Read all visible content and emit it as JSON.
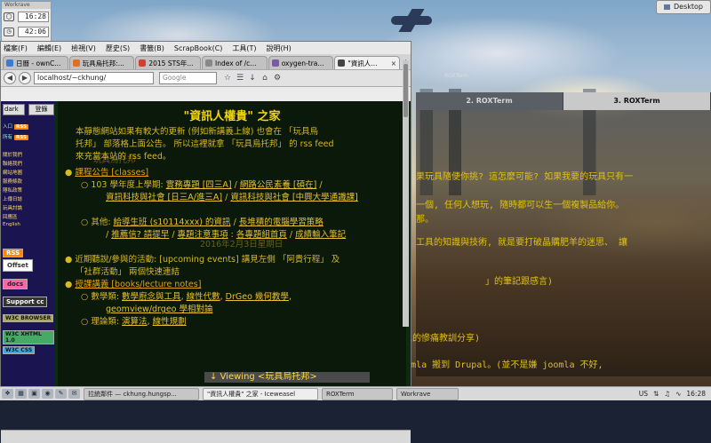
{
  "desktop": {
    "widget_title": "Workrave",
    "timer1": "16:28",
    "timer2": "42:06",
    "desktop_button": "Desktop",
    "term_window_title": "ROXTerm"
  },
  "roxterm": {
    "tabs": [
      "2. ROXTerm",
      "3. ROXTerm"
    ],
    "lines": [
      "果玩具隨便你挑? 這怎麼可能? 如果我要的玩具只有一",
      "一個, 任何人想玩, 隨時都可以生一個複製品給你。",
      "那。",
      "工具的知識與技術, 就是要打破晶購肥羊的迷思、 讓",
      "」的筆記跟感言)",
      "(和防遇天人的慘痛教訓分享)",
      "是 Joomla 搬到 Drupal。(並不是嫌 joomla 不好,"
    ]
  },
  "browser": {
    "menu": [
      "檔案(F)",
      "編輯(E)",
      "檢視(V)",
      "歷史(S)",
      "書籤(B)",
      "ScrapBook(C)",
      "工具(T)",
      "說明(H)"
    ],
    "tabs": [
      {
        "label": "日曆 - ownC...",
        "fav": "#3a7bd5",
        "active": false
      },
      {
        "label": "玩具烏托邦:...",
        "fav": "#e07020",
        "active": false
      },
      {
        "label": "2015 STS年...",
        "fav": "#d04030",
        "active": false
      },
      {
        "label": "Index of /c...",
        "fav": "#888888",
        "active": false
      },
      {
        "label": "oxygen-tra...",
        "fav": "#7a5aa0",
        "active": false
      },
      {
        "label": "\"資訊人...",
        "fav": "#444444",
        "active": true
      }
    ],
    "url": "localhost/~ckhung/",
    "search_placeholder": "Google",
    "window_title": "\"資訊人權貴\" 之家 - Iceweasel"
  },
  "sidebar": {
    "theme_select": "dark",
    "login_button": "登錄",
    "feed_labels": [
      "入口",
      "所有"
    ],
    "links": [
      "關於我們",
      "聯絡我們",
      "網站地圖",
      "服務條款",
      "隱私政策",
      "上傳日誌",
      "玩具討論",
      "回應區",
      "English"
    ],
    "badges": [
      "RSS",
      "Offset",
      "docs",
      "Support cc",
      "W3C BROWSER",
      "W3C XHTML 1.0",
      "W3C CSS"
    ]
  },
  "page": {
    "title": "\"資訊人權貴\" 之家",
    "intro_line1": "本靜態網站如果有較大的更新 (例如新講義上線) 也會在 「玩具烏",
    "intro_line2": "托邦」 部落格上面公告。 所以這裡就拿 「玩具烏托邦」 的 rss feed",
    "intro_line3": "來充當本站的 rss feed。",
    "classes_head": "課程公告 [classes]",
    "year_line": "103 學年度上學期:",
    "course1": "實務專題 [四三A]",
    "course2": "網路公民素養 [碩在]",
    "course3": "資訊科技與社會 [日三A/進三A]",
    "course4": "資訊科技與社會 [中興大學通識課]",
    "other_line": "其他:",
    "other1": "給導生班 (s10114xxx) 的資訊",
    "other2": "長堆積的電腦學習策略",
    "other3": "推薦信? 請提早",
    "other4": "專題注意事項",
    "other5": "各專題組首頁",
    "other6": "成績輸入筆記",
    "events_line": "近期聽說/參與的活動: [upcoming events] 講見左側 「阿貴行程」 及",
    "events_line2": "「社群活動」 兩個快速連結",
    "lecture_head": "授課講義 [books/lecture notes]",
    "math_label": "數學類:",
    "math1": "數學廚念與工具",
    "math2": "線性代數",
    "math3": "DrGeo 幾何教學",
    "math4": "geomview/drgeo 學相對論",
    "theory_label": "理論類:",
    "theory1": "演算法",
    "theory2": "線性規劃",
    "ghost_header": "玩具烏托邦",
    "ghost_date": "2016年2月3日星期日"
  },
  "status": {
    "viewing": "Viewing <玩具烏托邦>"
  },
  "taskbar": {
    "tasks": [
      {
        "label": "拉統鄰件 — ckhung.hungsp...",
        "active": false
      },
      {
        "label": "\"資訊人權貴\" 之家 - Iceweasel",
        "active": true
      },
      {
        "label": "ROXTerm",
        "active": false
      },
      {
        "label": "Workrave",
        "active": false
      }
    ],
    "tray_lang": "US",
    "clock": "16:28"
  }
}
